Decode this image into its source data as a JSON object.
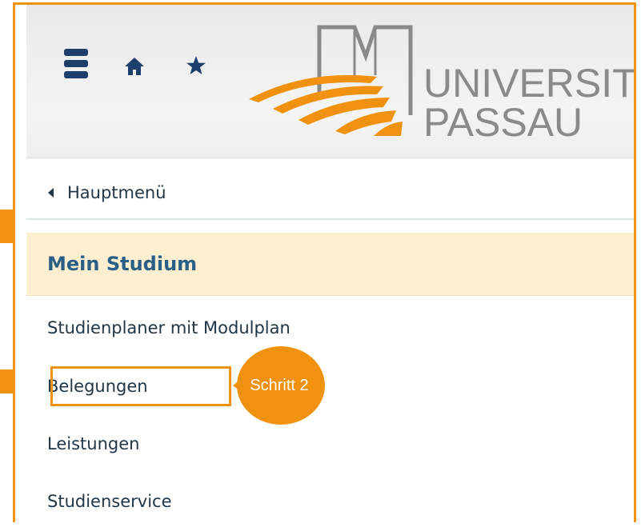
{
  "header": {
    "icons": {
      "menu": "hamburger-menu-icon",
      "home": "home-icon",
      "favorites": "star-icon"
    },
    "logo": {
      "line1": "UNIVERSITÄT",
      "line2": "PASSAU"
    }
  },
  "navigation": {
    "back_label": "Hauptmenü",
    "section_title": "Mein Studium",
    "items": [
      {
        "label": "Studienplaner mit Modulplan"
      },
      {
        "label": "Belegungen"
      },
      {
        "label": "Leistungen"
      },
      {
        "label": "Studienservice"
      }
    ]
  },
  "annotation": {
    "step_label": "Schritt 2"
  },
  "colors": {
    "accent_orange": "#f0920f",
    "icon_blue": "#1e3f6b",
    "section_bg": "#fdefcf",
    "section_text": "#2a5f86",
    "text": "#233646"
  }
}
